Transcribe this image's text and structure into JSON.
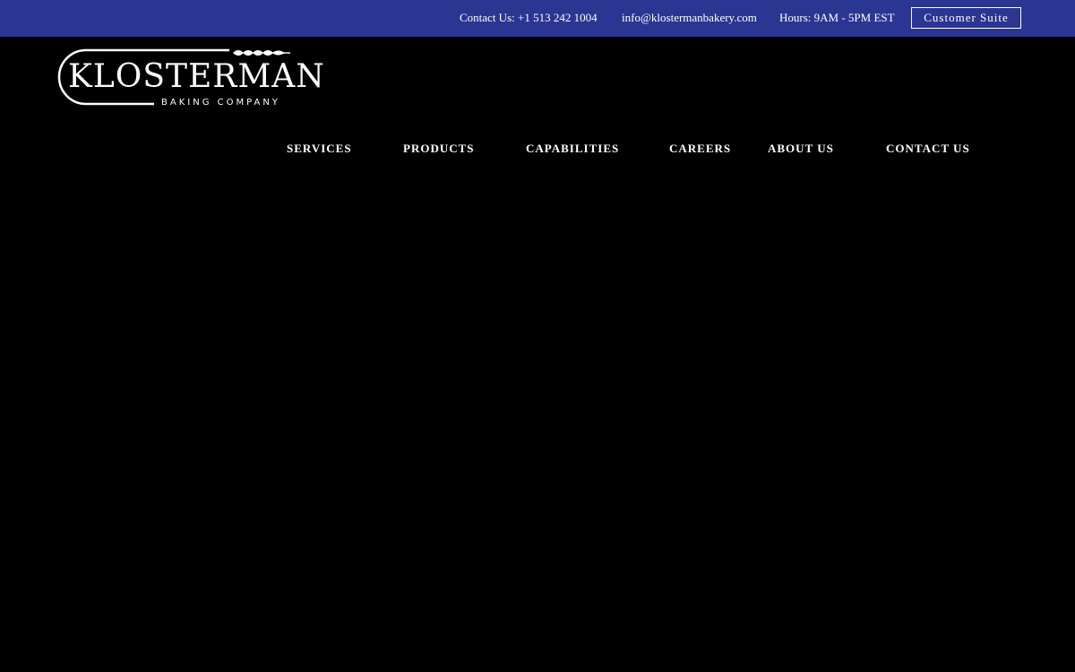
{
  "topbar": {
    "phone": "Contact Us: +1 513 242 1004",
    "email": "info@klostermanbakery.com",
    "hours": "Hours: 9AM - 5PM EST",
    "customer_suite": "Customer Suite"
  },
  "logo": {
    "name": "KLOSTERMAN",
    "tagline": "BAKING COMPANY",
    "icon": "wheat-icon"
  },
  "nav": {
    "items": [
      {
        "label": "SERVICES"
      },
      {
        "label": "PRODUCTS"
      },
      {
        "label": "CAPABILITIES"
      },
      {
        "label": "CAREERS"
      },
      {
        "label": "ABOUT US"
      },
      {
        "label": "CONTACT US"
      }
    ]
  },
  "colors": {
    "topbar": "#2b3592",
    "background": "#000000",
    "text": "#ffffff"
  }
}
